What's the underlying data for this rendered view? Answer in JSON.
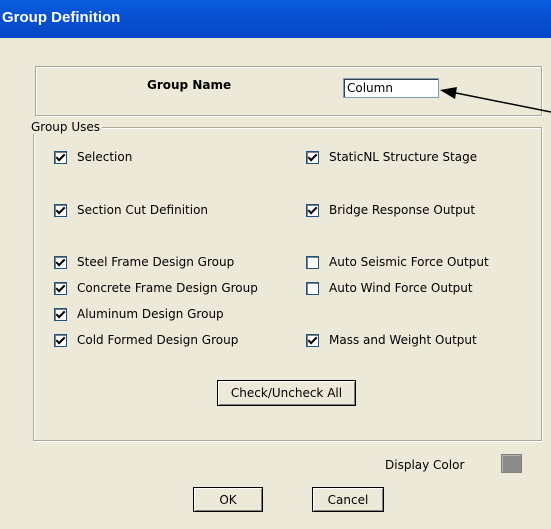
{
  "window": {
    "title": "Group Definition"
  },
  "group_name": {
    "label": "Group Name",
    "value": "Column"
  },
  "group_uses": {
    "legend": "Group Uses",
    "left_options": [
      {
        "label": "Selection",
        "checked": true
      },
      {
        "label": "Section Cut Definition",
        "checked": true
      },
      {
        "label": "Steel Frame Design Group",
        "checked": true
      },
      {
        "label": "Concrete Frame Design Group",
        "checked": true
      },
      {
        "label": "Aluminum Design Group",
        "checked": true
      },
      {
        "label": "Cold Formed Design Group",
        "checked": true
      }
    ],
    "right_options": [
      {
        "label": "StaticNL Structure Stage",
        "checked": true
      },
      {
        "label": "Bridge Response Output",
        "checked": true
      },
      {
        "label": "Auto Seismic Force Output",
        "checked": false
      },
      {
        "label": "Auto Wind Force Output",
        "checked": false
      },
      {
        "label": "Mass and Weight Output",
        "checked": true
      }
    ],
    "check_all_button": "Check/Uncheck All"
  },
  "display_color": {
    "label": "Display Color",
    "color": "#8c8c8c"
  },
  "buttons": {
    "ok": "OK",
    "cancel": "Cancel"
  },
  "colors": {
    "titlebar": "#0750d0",
    "dialog_bg": "#ece9d8"
  }
}
